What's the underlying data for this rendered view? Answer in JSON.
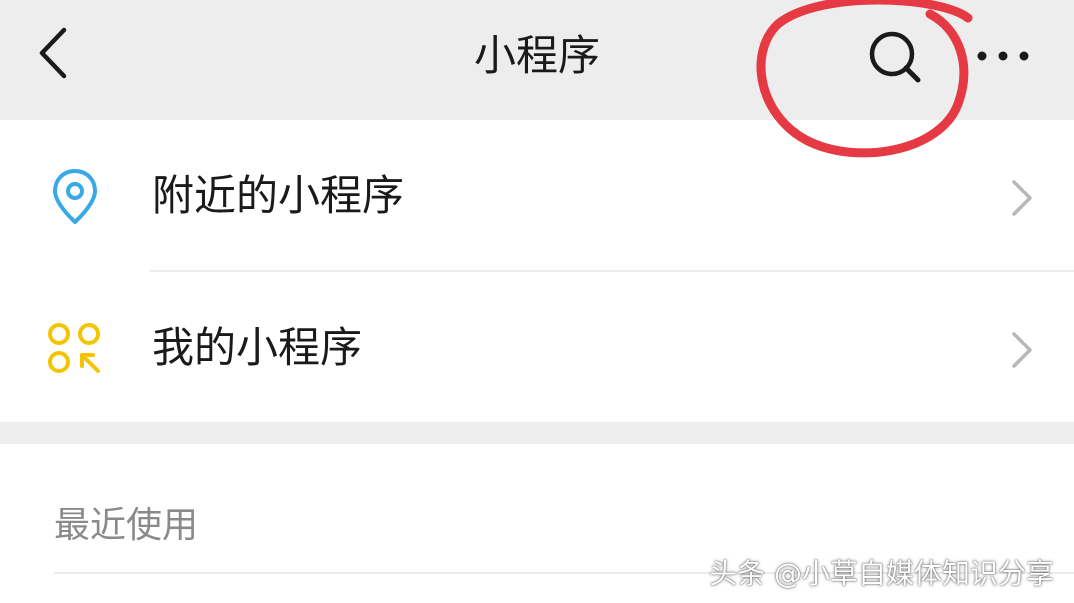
{
  "header": {
    "title": "小程序",
    "back_icon": "chevron-left-icon",
    "search_icon": "search-icon",
    "more_icon": "more-dots-icon"
  },
  "menu": {
    "items": [
      {
        "label": "附近的小程序",
        "icon": "location-pin-icon",
        "icon_color": "#3aa8e8"
      },
      {
        "label": "我的小程序",
        "icon": "mini-program-icon",
        "icon_color": "#f5c400"
      }
    ]
  },
  "recent": {
    "header": "最近使用"
  },
  "watermark": {
    "text": "头条 @小草自媒体知识分享"
  },
  "colors": {
    "background": "#ededed",
    "card": "#ffffff",
    "annotation_red": "#e53a43",
    "text_primary": "#1a1a1a",
    "text_secondary": "#8a8a8a",
    "chevron": "#b8b8b8"
  }
}
